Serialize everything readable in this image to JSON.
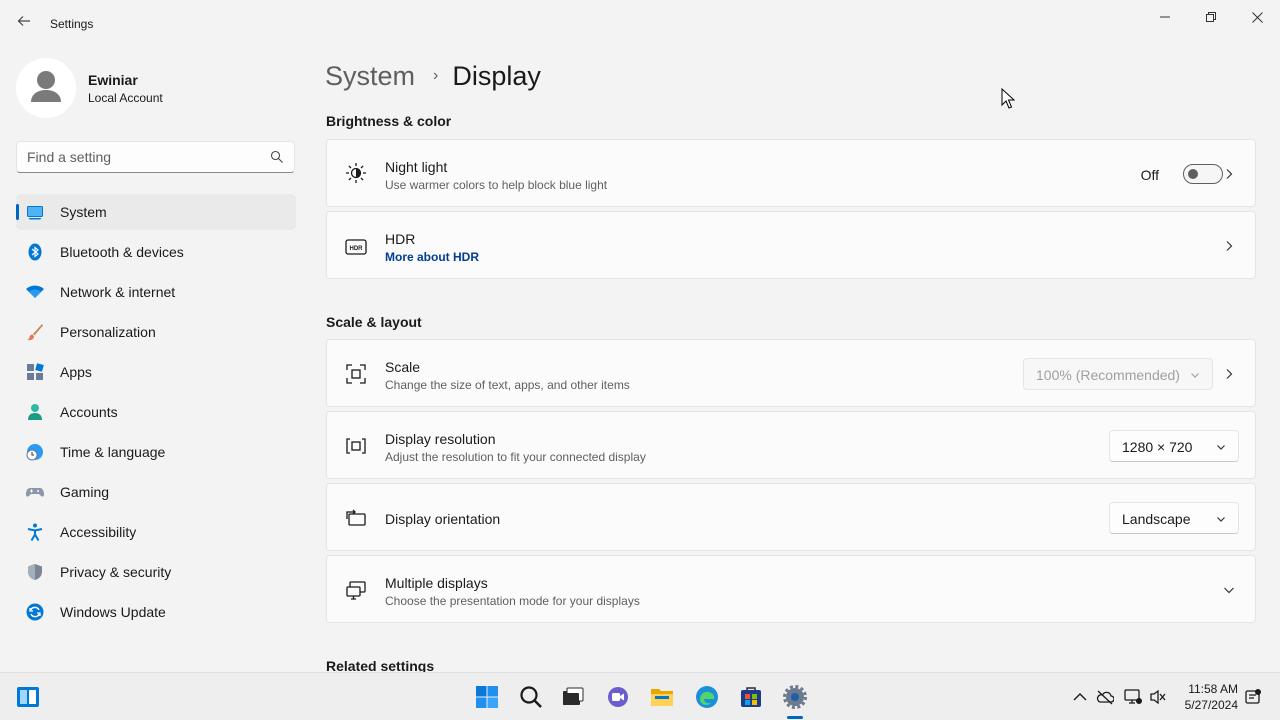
{
  "window": {
    "title": "Settings",
    "back_icon": "back-arrow-icon",
    "controls": [
      "minimize-icon",
      "maximize-icon",
      "close-icon"
    ]
  },
  "account": {
    "name": "Ewiniar",
    "type": "Local Account"
  },
  "search": {
    "placeholder": "Find a setting",
    "icon": "search-icon"
  },
  "sidebar": {
    "items": [
      {
        "label": "System",
        "icon": "system-icon",
        "active": true
      },
      {
        "label": "Bluetooth & devices",
        "icon": "bluetooth-icon"
      },
      {
        "label": "Network & internet",
        "icon": "wifi-icon"
      },
      {
        "label": "Personalization",
        "icon": "brush-icon"
      },
      {
        "label": "Apps",
        "icon": "apps-icon"
      },
      {
        "label": "Accounts",
        "icon": "accounts-icon"
      },
      {
        "label": "Time & language",
        "icon": "time-language-icon"
      },
      {
        "label": "Gaming",
        "icon": "gamepad-icon"
      },
      {
        "label": "Accessibility",
        "icon": "accessibility-icon"
      },
      {
        "label": "Privacy & security",
        "icon": "shield-icon"
      },
      {
        "label": "Windows Update",
        "icon": "windows-update-icon"
      }
    ]
  },
  "breadcrumb": {
    "parent": "System",
    "separator": "›",
    "current": "Display"
  },
  "sections": {
    "brightness": "Brightness & color",
    "scale_layout": "Scale & layout",
    "related": "Related settings"
  },
  "cards": {
    "night_light": {
      "title": "Night light",
      "subtitle": "Use warmer colors to help block blue light",
      "toggle_state": "Off",
      "toggle_on": false,
      "icon": "brightness-icon"
    },
    "hdr": {
      "title": "HDR",
      "link": "More about HDR",
      "icon": "hdr-icon"
    },
    "scale": {
      "title": "Scale",
      "subtitle": "Change the size of text, apps, and other items",
      "value": "100% (Recommended)",
      "icon": "scale-icon"
    },
    "resolution": {
      "title": "Display resolution",
      "subtitle": "Adjust the resolution to fit your connected display",
      "value": "1280 × 720",
      "icon": "resolution-icon"
    },
    "orientation": {
      "title": "Display orientation",
      "value": "Landscape",
      "icon": "orientation-icon"
    },
    "multiple": {
      "title": "Multiple displays",
      "subtitle": "Choose the presentation mode for your displays",
      "icon": "multiple-displays-icon"
    }
  },
  "taskbar": {
    "apps": [
      "start-icon",
      "search-icon",
      "task-view-icon",
      "chat-icon",
      "file-explorer-icon",
      "edge-icon",
      "store-icon",
      "settings-icon"
    ],
    "tray": [
      "chevron-up-icon",
      "onedrive-icon",
      "network-icon",
      "volume-icon",
      "notification-icon"
    ],
    "time": "11:58 AM",
    "date": "5/27/2024"
  },
  "colors": {
    "accent": "#0067c0",
    "link": "#003e92",
    "background": "#f3f3f3",
    "card": "#fbfbfb"
  }
}
